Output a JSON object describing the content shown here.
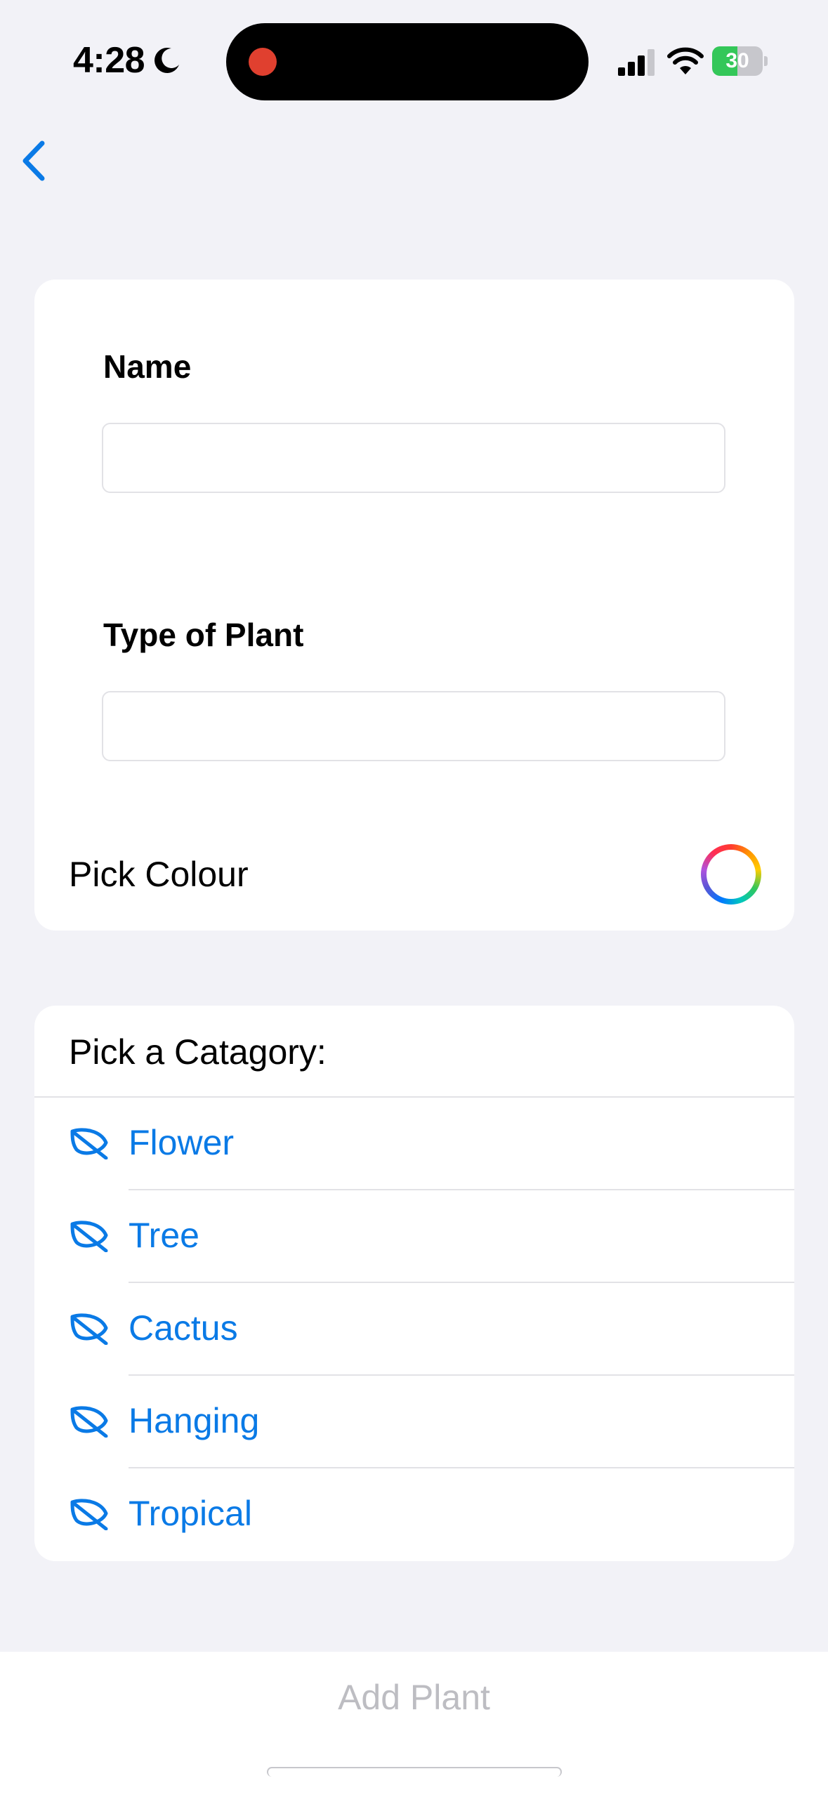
{
  "status_bar": {
    "time": "4:28",
    "battery": "30"
  },
  "nav": {
    "back_icon": "chevron-left-icon"
  },
  "form": {
    "name_label": "Name",
    "name_value": "",
    "type_label": "Type of Plant",
    "type_value": "",
    "colour_label": "Pick Colour"
  },
  "category": {
    "header": "Pick a Catagory:",
    "items": [
      {
        "label": "Flower",
        "icon": "leaf-icon"
      },
      {
        "label": "Tree",
        "icon": "leaf-icon"
      },
      {
        "label": "Cactus",
        "icon": "leaf-icon"
      },
      {
        "label": "Hanging",
        "icon": "leaf-icon"
      },
      {
        "label": "Tropical",
        "icon": "leaf-icon"
      }
    ]
  },
  "footer": {
    "add_label": "Add Plant"
  },
  "colors": {
    "accent": "#0a7ae6",
    "disabled": "#bdbdc2",
    "background": "#f2f2f7",
    "recording": "#e0402f",
    "battery": "#34c759"
  }
}
